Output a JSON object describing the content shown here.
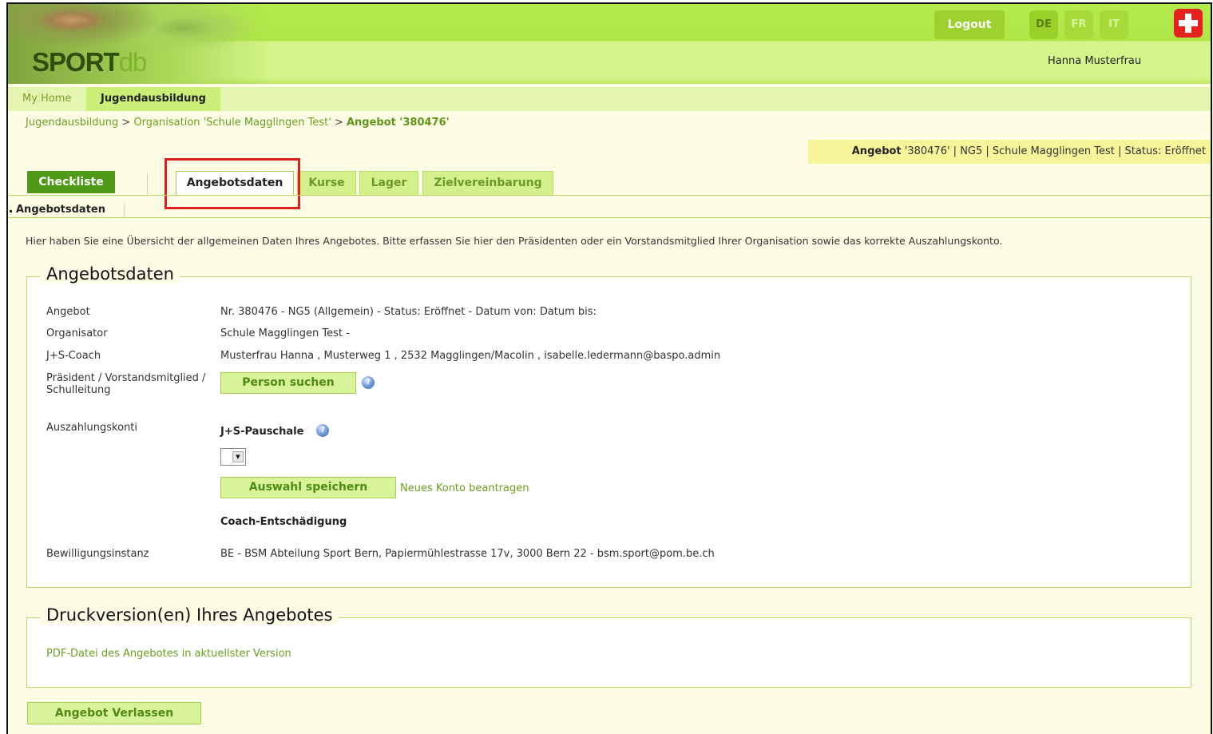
{
  "header": {
    "logo_part1": "SPORT",
    "logo_part2": "db",
    "logout_label": "Logout",
    "languages": [
      "DE",
      "FR",
      "IT"
    ],
    "active_language": "DE",
    "user_name": "Hanna Musterfrau",
    "swiss_icon": "swiss-cross-icon"
  },
  "topnav": {
    "home_label": "My Home",
    "jugend_label": "Jugendausbildung"
  },
  "breadcrumb": {
    "item1": "Jugendausbildung",
    "sep": ">",
    "item2": "Organisation 'Schule Magglingen Test'",
    "item3": "Angebot '380476'"
  },
  "status_bar": {
    "prefix": "Angebot",
    "text": " '380476' | NG5 | Schule Magglingen Test | Status: Eröffnet"
  },
  "tabs": {
    "checkliste": "Checkliste",
    "angebotsdaten": "Angebotsdaten",
    "kurse": "Kurse",
    "lager": "Lager",
    "zielvereinbarung": "Zielvereinbarung"
  },
  "subtab": "Angebotsdaten",
  "intro": "Hier haben Sie eine Übersicht der allgemeinen Daten Ihres Angebotes. Bitte erfassen Sie hier den Präsidenten oder ein Vorstandsmitglied Ihrer Organisation sowie das korrekte Auszahlungskonto.",
  "angebotsdaten": {
    "legend": "Angebotsdaten",
    "angebot_label": "Angebot",
    "angebot_value": "Nr. 380476 - NG5 (Allgemein) - Status: Eröffnet - Datum von: Datum bis:",
    "organisator_label": "Organisator",
    "organisator_value": "Schule Magglingen Test -",
    "coach_label": "J+S-Coach",
    "coach_value": "Musterfrau Hanna , Musterweg 1 , 2532 Magglingen/Macolin , isabelle.ledermann@baspo.admin",
    "praesident_label_1": "Präsident / Vorstandsmitglied /",
    "praesident_label_2": "Schulleitung",
    "person_suchen": "Person suchen",
    "auszahlung_label": "Auszahlungskonti",
    "pauschale_label": "J+S-Pauschale",
    "auswahl_speichern": "Auswahl speichern",
    "neues_konto": "Neues Konto beantragen",
    "coach_entschaedigung": "Coach-Entschädigung",
    "bewilligung_label": "Bewilligungsinstanz",
    "bewilligung_value": "BE - BSM Abteilung Sport Bern, Papiermühlestrasse 17v, 3000 Bern 22 - bsm.sport@pom.be.ch"
  },
  "druck": {
    "legend": "Druckversion(en) Ihres Angebotes",
    "pdf_link": "PDF-Datei des Angebotes in aktuellster Version"
  },
  "leave_button": "Angebot Verlassen",
  "colors": {
    "accent_green": "#4f9a18",
    "header_green": "#b0e648",
    "highlight_red": "#e0201e",
    "status_yellow": "#f6f59a"
  }
}
